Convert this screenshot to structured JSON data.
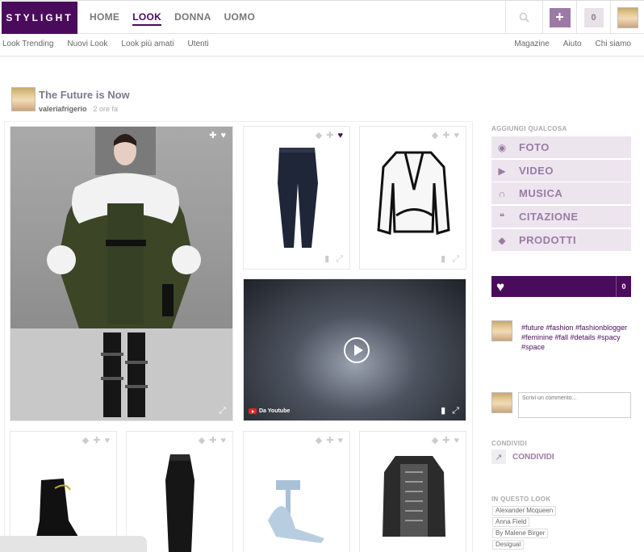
{
  "header": {
    "logo": "STYLIGHT",
    "nav": [
      {
        "label": "HOME",
        "active": false
      },
      {
        "label": "LOOK",
        "active": true
      },
      {
        "label": "DONNA",
        "active": false
      },
      {
        "label": "UOMO",
        "active": false
      }
    ],
    "count": "0"
  },
  "subnav": {
    "left": [
      "Look Trending",
      "Nuovi Look",
      "Look più amati",
      "Utenti"
    ],
    "right": [
      "Magazine",
      "Aiuto",
      "Chi siamo"
    ]
  },
  "post": {
    "title": "The Future is Now",
    "author": "valeriafrigerio",
    "time": "2 ore fa"
  },
  "video": {
    "source_label": "Da Youtube"
  },
  "sidebar": {
    "add_title": "AGGIUNGI QUALCOSA",
    "add_items": [
      {
        "label": "FOTO",
        "icon": "camera-icon"
      },
      {
        "label": "VIDEO",
        "icon": "video-icon"
      },
      {
        "label": "MUSICA",
        "icon": "headphones-icon"
      },
      {
        "label": "CITAZIONE",
        "icon": "quote-icon"
      },
      {
        "label": "PRODOTTI",
        "icon": "tag-icon"
      }
    ],
    "like_count": "0",
    "tags": "#future #fashion #fashionblogger #feminine #fall #details #spacy #space",
    "comment_placeholder": "Scrivi un commento...",
    "share_title": "CONDIVIDI",
    "share_label": "CONDIVIDI",
    "brands_title": "IN QUESTO LOOK",
    "brands": [
      "Alexander Mcqueen",
      "Anna Field",
      "By Malene Birger",
      "Desigual"
    ]
  },
  "colors": {
    "brand": "#4b0b5c",
    "accent": "#9c7aa6",
    "button_bg": "#ece5ee"
  }
}
